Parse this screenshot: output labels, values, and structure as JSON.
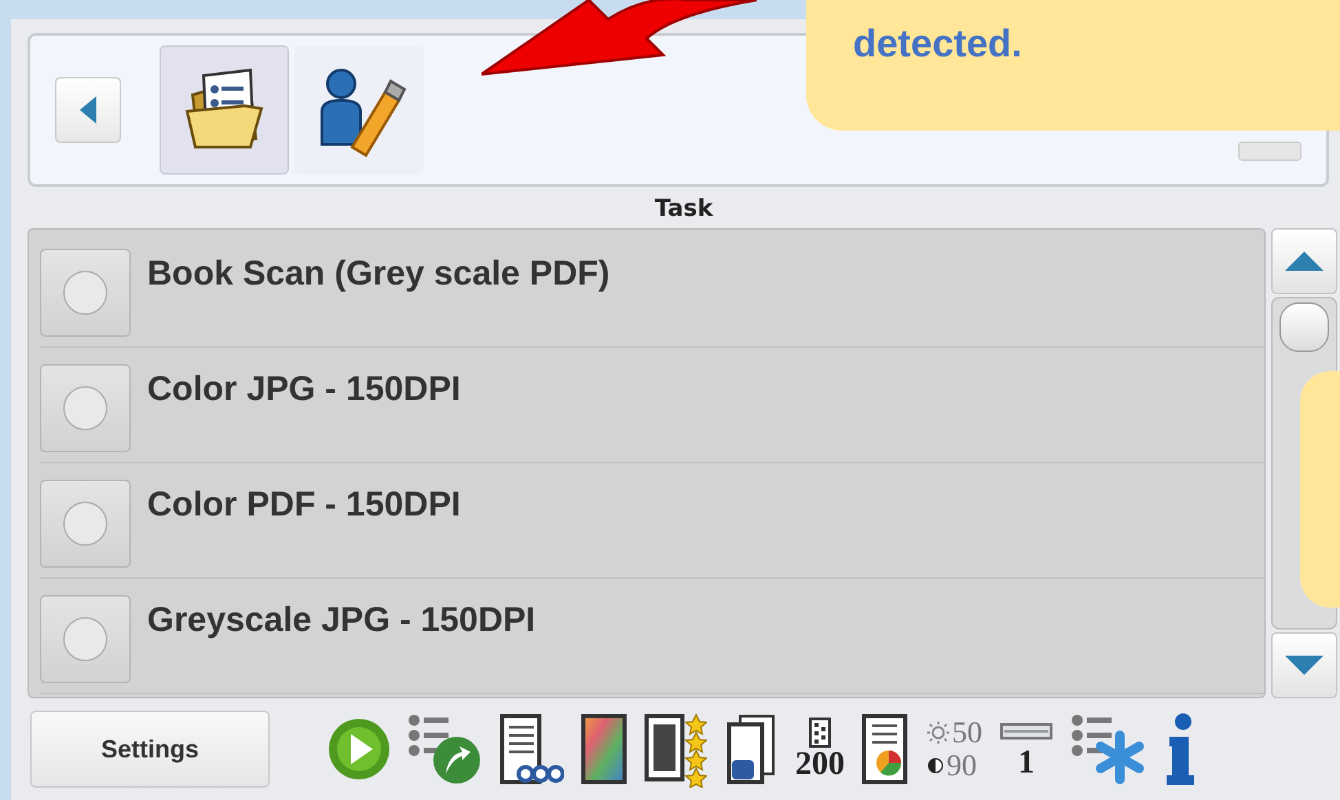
{
  "toolbar": {
    "profiles": [
      {
        "kind": "folder",
        "selected": true
      },
      {
        "kind": "usb",
        "selected": false
      }
    ]
  },
  "callout": {
    "text": "detected."
  },
  "task_label": "Task",
  "tasks": [
    {
      "name": "Book Scan (Grey scale PDF)",
      "selected": false
    },
    {
      "name": "Color JPG - 150DPI",
      "selected": false
    },
    {
      "name": "Color PDF - 150DPI",
      "selected": false
    },
    {
      "name": "Greyscale JPG - 150DPI",
      "selected": false
    }
  ],
  "settings_button": "Settings",
  "status_icons": [
    {
      "kind": "start"
    },
    {
      "kind": "shortcut"
    },
    {
      "kind": "document-dots"
    },
    {
      "kind": "color"
    },
    {
      "kind": "jpg"
    },
    {
      "kind": "pages-2"
    },
    {
      "kind": "resolution",
      "label": "200"
    },
    {
      "kind": "report"
    },
    {
      "kind": "brightness",
      "brightness": "50",
      "contrast": "90"
    },
    {
      "kind": "tray",
      "label": "1"
    },
    {
      "kind": "list-star"
    },
    {
      "kind": "info"
    }
  ]
}
